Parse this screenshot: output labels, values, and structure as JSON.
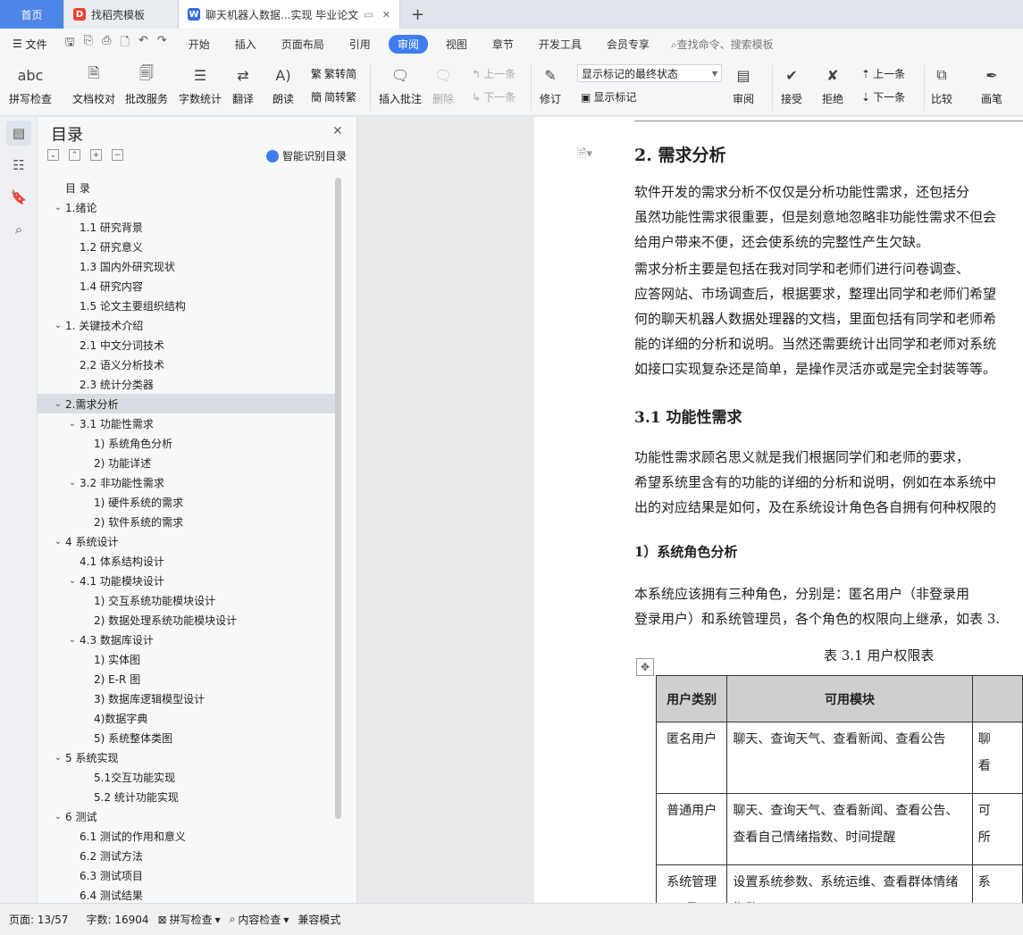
{
  "tabs": [
    {
      "label": "首页"
    },
    {
      "label": "找稻壳模板"
    },
    {
      "label": "聊天机器人数据...实现 毕业论文"
    }
  ],
  "menu": {
    "file": "文件",
    "items": [
      "开始",
      "插入",
      "页面布局",
      "引用",
      "审阅",
      "视图",
      "章节",
      "开发工具",
      "会员专享"
    ],
    "active": "审阅",
    "search": "查找命令、搜索模板"
  },
  "ribbon": {
    "spell": "拼写检查",
    "doc_check": "文档校对",
    "batch": "批改服务",
    "word_count": "字数统计",
    "translate": "翻译",
    "read": "朗读",
    "trad": "繁转简",
    "simp": "简转繁",
    "insert_comment": "插入批注",
    "delete": "删除",
    "prev": "上一条",
    "next": "下一条",
    "revise": "修订",
    "markup_select": "显示标记的最终状态",
    "show_markup": "显示标记",
    "review": "审阅",
    "accept": "接受",
    "reject": "拒绝",
    "prev2": "上一条",
    "next2": "下一条",
    "compare": "比较",
    "pen": "画笔"
  },
  "toc": {
    "title": "目录",
    "smart": "智能识别目录",
    "items": [
      {
        "text": "目  录",
        "level": 0,
        "caret": ""
      },
      {
        "text": "1.绪论",
        "level": 0,
        "caret": "v"
      },
      {
        "text": "1.1  研究背景",
        "level": 1,
        "caret": ""
      },
      {
        "text": "1.2  研究意义",
        "level": 1,
        "caret": ""
      },
      {
        "text": "1.3  国内外研究现状",
        "level": 1,
        "caret": ""
      },
      {
        "text": "1.4  研究内容",
        "level": 1,
        "caret": ""
      },
      {
        "text": "1.5  论文主要组织结构",
        "level": 1,
        "caret": ""
      },
      {
        "text": "1.  关键技术介绍",
        "level": 0,
        "caret": "v"
      },
      {
        "text": "2.1  中文分词技术",
        "level": 1,
        "caret": ""
      },
      {
        "text": "2.2  语义分析技术",
        "level": 1,
        "caret": ""
      },
      {
        "text": "2.3  统计分类器",
        "level": 1,
        "caret": ""
      },
      {
        "text": "2.需求分析",
        "level": 0,
        "caret": "v",
        "selected": true
      },
      {
        "text": "3.1  功能性需求",
        "level": 1,
        "caret": "v"
      },
      {
        "text": "1)  系统角色分析",
        "level": 2,
        "caret": ""
      },
      {
        "text": "2)  功能详述",
        "level": 2,
        "caret": ""
      },
      {
        "text": "3.2  非功能性需求",
        "level": 1,
        "caret": "v"
      },
      {
        "text": "1)  硬件系统的需求",
        "level": 2,
        "caret": ""
      },
      {
        "text": "2)  软件系统的需求",
        "level": 2,
        "caret": ""
      },
      {
        "text": "4  系统设计",
        "level": 0,
        "caret": "v"
      },
      {
        "text": "4.1  体系结构设计",
        "level": 1,
        "caret": ""
      },
      {
        "text": "4.1  功能模块设计",
        "level": 1,
        "caret": "v"
      },
      {
        "text": "1)  交互系统功能模块设计",
        "level": 2,
        "caret": ""
      },
      {
        "text": "2)  数据处理系统功能模块设计",
        "level": 2,
        "caret": ""
      },
      {
        "text": "4.3  数据库设计",
        "level": 1,
        "caret": "v"
      },
      {
        "text": "1)  实体图",
        "level": 2,
        "caret": ""
      },
      {
        "text": "2)    E-R 图",
        "level": 2,
        "caret": ""
      },
      {
        "text": "3)  数据库逻辑模型设计",
        "level": 2,
        "caret": ""
      },
      {
        "text": "4)数据字典",
        "level": 2,
        "caret": ""
      },
      {
        "text": "5)  系统整体类图",
        "level": 2,
        "caret": ""
      },
      {
        "text": "5  系统实现",
        "level": 0,
        "caret": "v"
      },
      {
        "text": "5.1交互功能实现",
        "level": 2,
        "caret": ""
      },
      {
        "text": "5.2  统计功能实现",
        "level": 2,
        "caret": ""
      },
      {
        "text": "6  测试",
        "level": 0,
        "caret": "v"
      },
      {
        "text": "6.1  测试的作用和意义",
        "level": 1,
        "caret": ""
      },
      {
        "text": "6.2  测试方法",
        "level": 1,
        "caret": ""
      },
      {
        "text": "6.3  测试项目",
        "level": 1,
        "caret": ""
      },
      {
        "text": "6.4  测试结果",
        "level": 1,
        "caret": ""
      }
    ]
  },
  "doc": {
    "h1": "2.  需求分析",
    "p1": [
      "        软件开发的需求分析不仅仅是分析功能性需求，还包括分",
      "虽然功能性需求很重要，但是刻意地忽略非功能性需求不但会",
      "给用户带来不便，还会使系统的完整性产生欠缺。"
    ],
    "p2": [
      "        需求分析主要是包括在我对同学和老师们进行问卷调查、",
      "应答网站、市场调查后，根据要求，整理出同学和老师们希望",
      "何的聊天机器人数据处理器的文档，里面包括有同学和老师希",
      "能的详细的分析和说明。当然还需要统计出同学和老师对系统",
      "如接口实现复杂还是简单，是操作灵活亦或是完全封装等等。"
    ],
    "h2": "3.1  功能性需求",
    "p3": [
      "        功能性需求顾名思义就是我们根据同学们和老师的要求，",
      "希望系统里含有的功能的详细的分析和说明，例如在本系统中",
      "出的对应结果是如何，及在系统设计角色各自拥有何种权限的"
    ],
    "h3": "1）系统角色分析",
    "p4": [
      "        本系统应该拥有三种角色，分别是：匿名用户（非登录用",
      "登录用户）和系统管理员，各个角色的权限向上继承，如表 3."
    ],
    "caption": "表 3.1   用户权限表",
    "table": {
      "headers": [
        "用户类别",
        "可用模块",
        ""
      ],
      "rows": [
        [
          "匿名用户",
          "聊天、查询天气、查看新闻、查看公告",
          "聊\n看"
        ],
        [
          "普通用户",
          "聊天、查询天气、查看新闻、查看公告、查看自己情绪指数、时间提醒",
          "可\n所"
        ],
        [
          "系统管理员",
          "设置系统参数、系统运维、查看群体情绪指数、",
          "系"
        ]
      ]
    }
  },
  "status": {
    "page": "页面: 13/57",
    "words": "字数: 16904",
    "spell": "拼写检查",
    "content": "内容检查",
    "mode": "兼容模式"
  }
}
